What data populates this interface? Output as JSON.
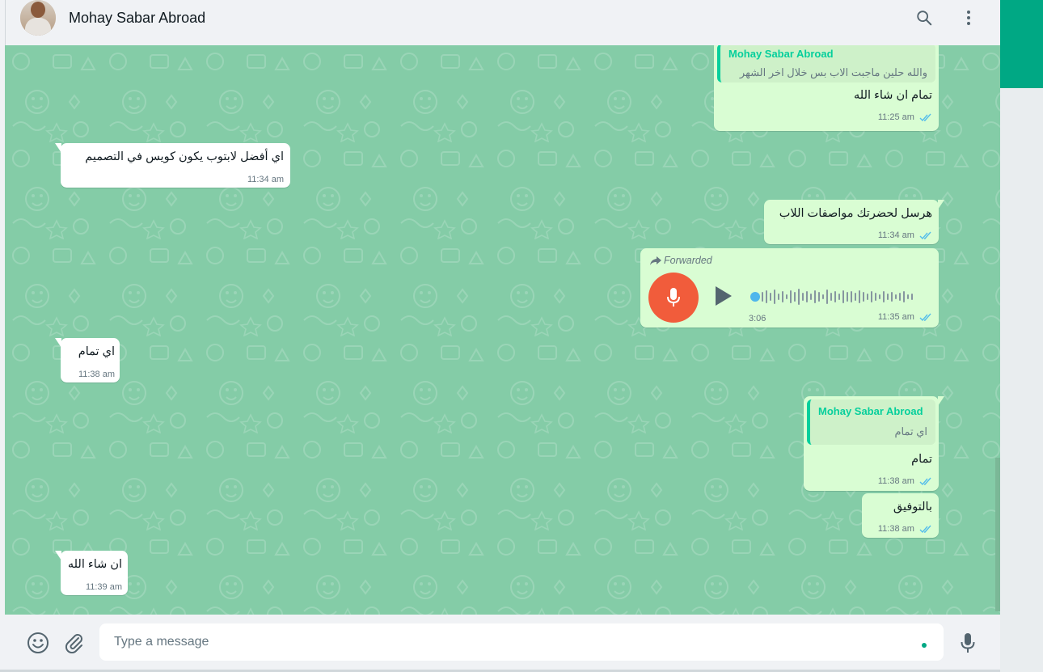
{
  "header": {
    "contact_name": "Mohay Sabar Abroad"
  },
  "messages": [
    {
      "direction": "out",
      "quote_author": "Mohay Sabar Abroad",
      "quote_text": "والله حلين ماجبت الاب بس خلال اخر الشهر",
      "text": "تمام ان شاء الله",
      "time": "11:25 am"
    },
    {
      "direction": "in",
      "text": "اي أفضل لابتوب يكون كويس في التصميم",
      "time": "11:34 am"
    },
    {
      "direction": "out",
      "text": "هرسل لحضرتك مواصفات اللاب",
      "time": "11:34 am"
    },
    {
      "direction": "out",
      "type": "voice",
      "forwarded_label": "Forwarded",
      "duration": "3:06",
      "time": "11:35 am"
    },
    {
      "direction": "in",
      "text": "اي تمام",
      "time": "11:38 am"
    },
    {
      "direction": "out",
      "quote_author": "Mohay Sabar Abroad",
      "quote_text": "اي تمام",
      "text": "تمام",
      "time": "11:38 am"
    },
    {
      "direction": "out",
      "text": "بالتوفيق",
      "time": "11:38 am"
    },
    {
      "direction": "in",
      "text": "ان شاء الله",
      "time": "11:39 am"
    }
  ],
  "footer": {
    "placeholder": "Type a message"
  },
  "icons": {
    "search": "search-icon",
    "menu": "menu-icon",
    "emoji": "emoji-icon",
    "attach": "attach-icon",
    "mic": "mic-icon"
  },
  "colors": {
    "accent": "#00a884",
    "chat_bg": "#84cca7",
    "bubble_out": "#d9fdd3",
    "bubble_in": "#ffffff",
    "quote_bar": "#06cf9c",
    "voice_button": "#f15c3b",
    "read_ticks": "#53bdeb"
  }
}
